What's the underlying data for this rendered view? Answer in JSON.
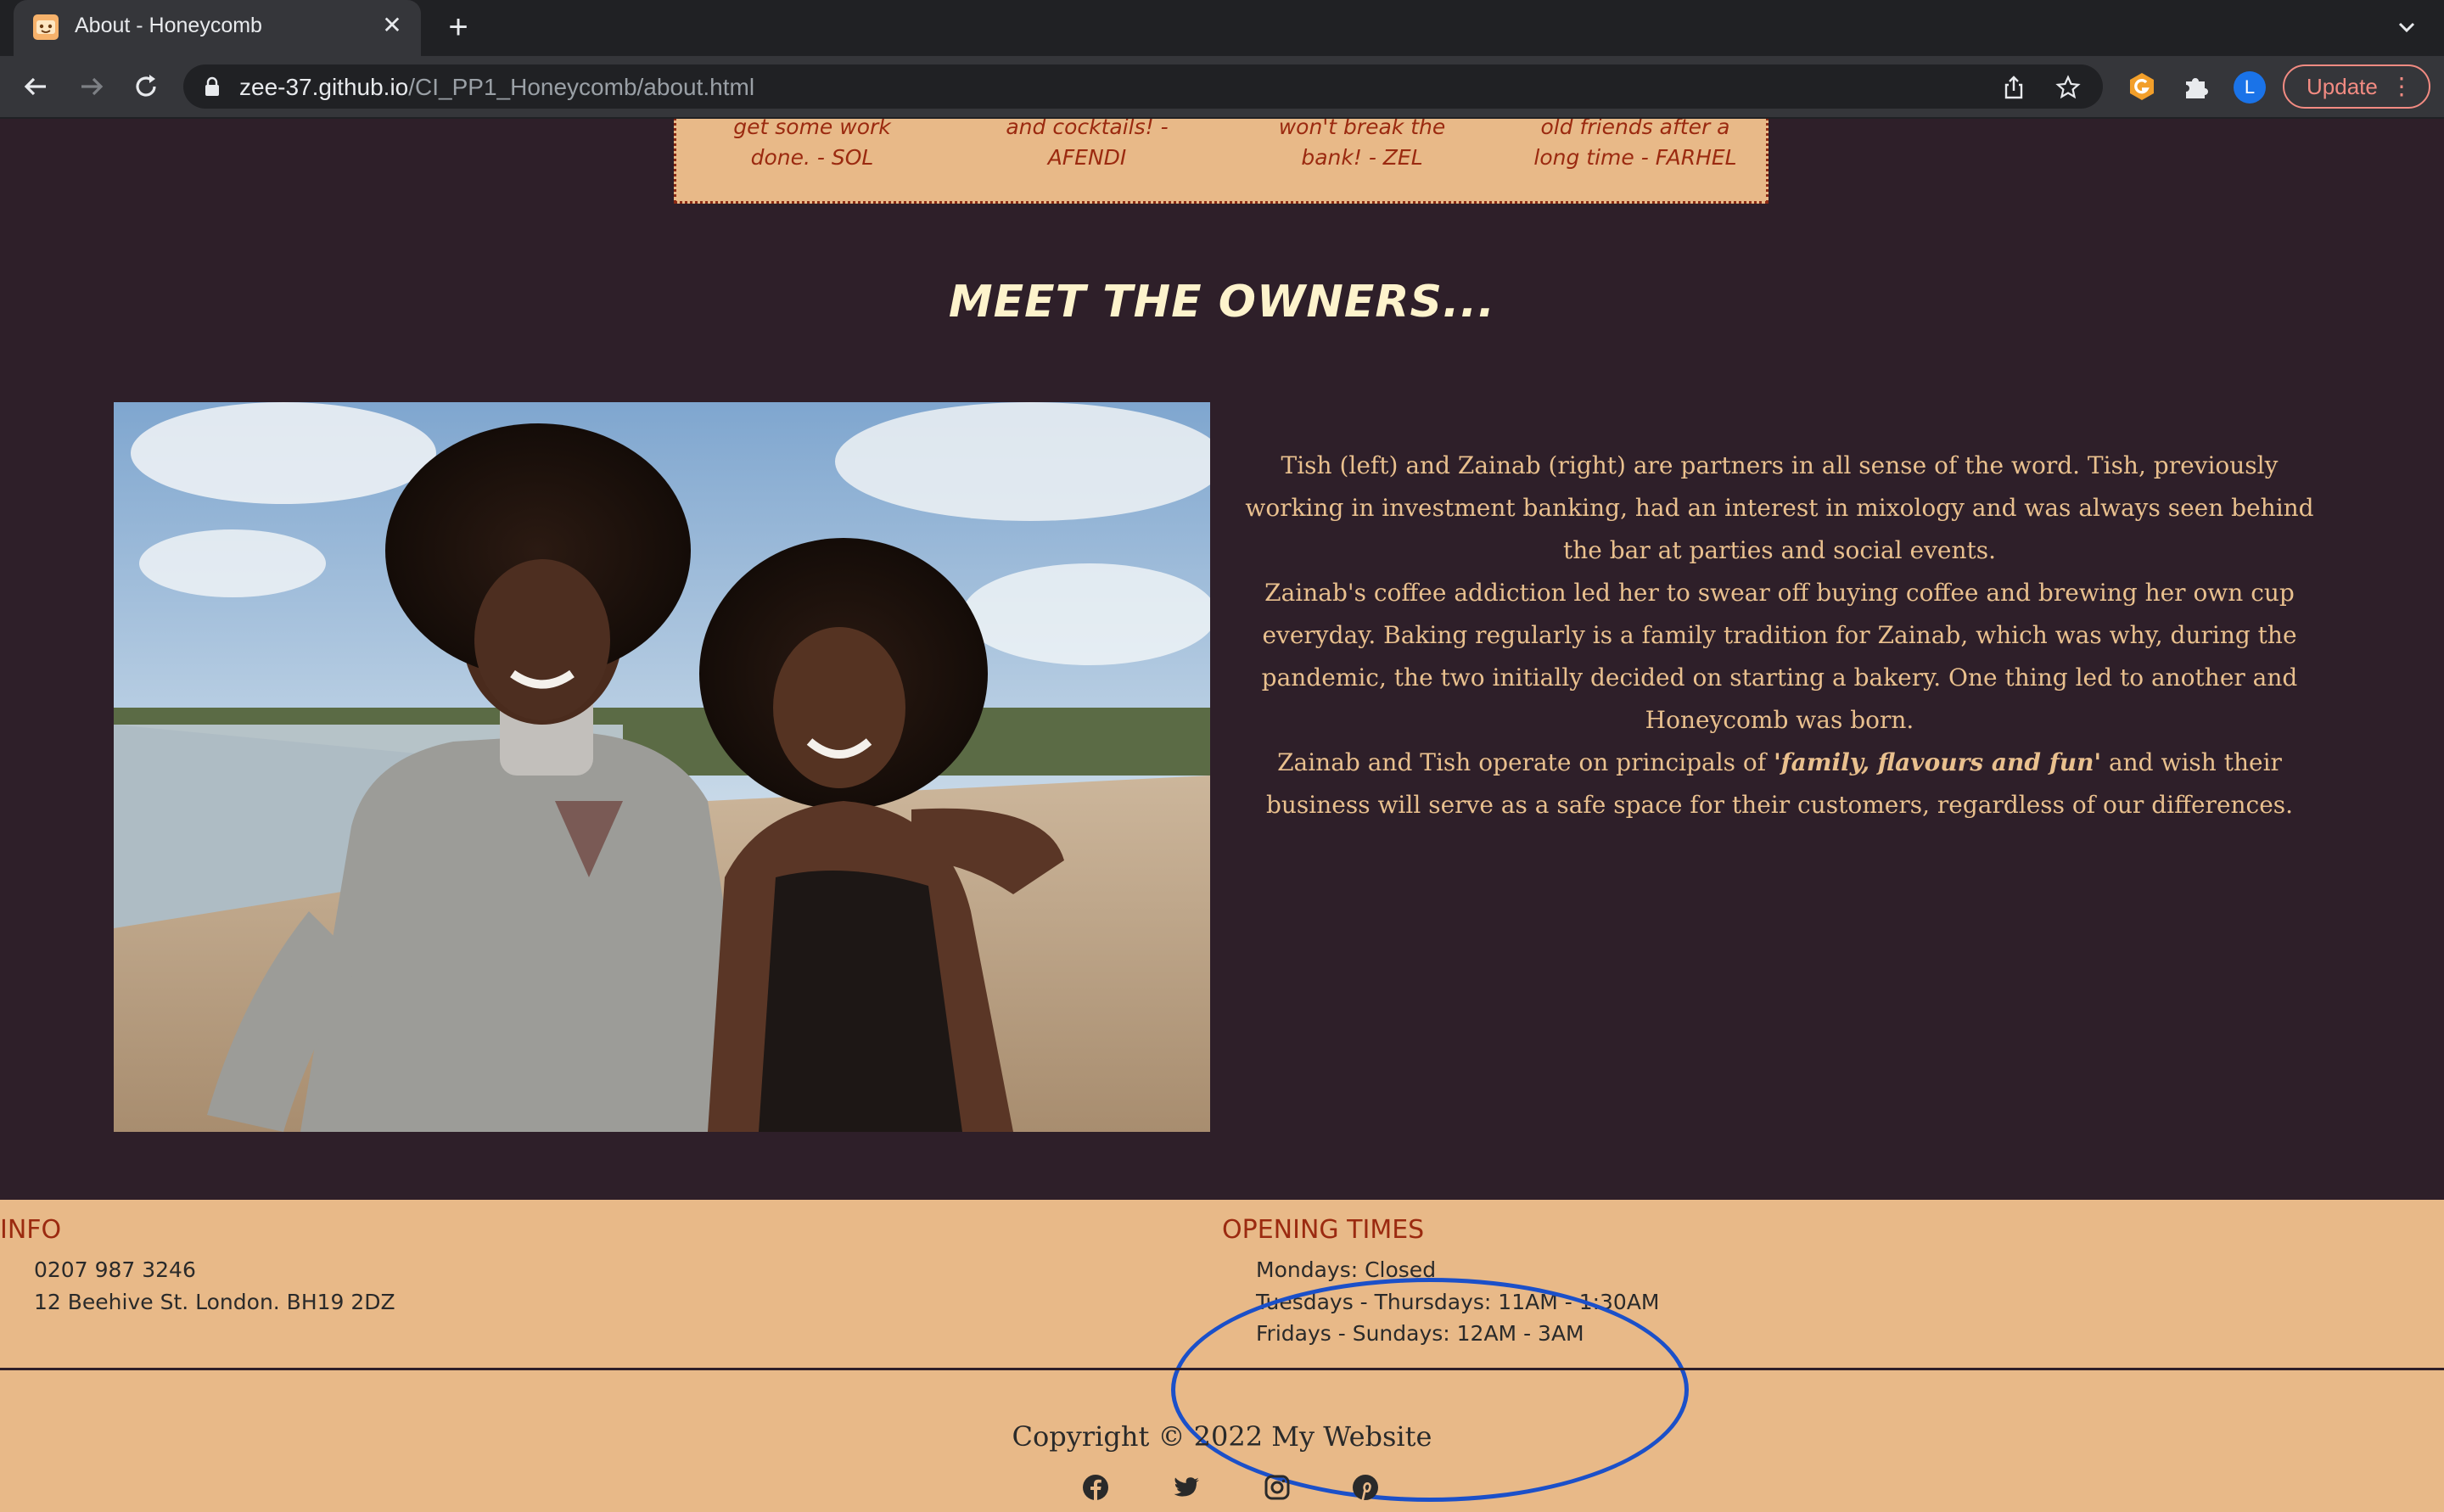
{
  "browser": {
    "tab_title": "About - Honeycomb",
    "close_glyph": "✕",
    "new_tab_glyph": "+",
    "url_host": "zee-37.github.io",
    "url_path": "/CI_PP1_Honeycomb/about.html",
    "profile_initial": "L",
    "update_label": "Update",
    "update_menu_glyph": "⋮"
  },
  "reviews": [
    {
      "text": "get some work done. - SOL"
    },
    {
      "text": "and cocktails! - AFENDI"
    },
    {
      "text": "won't break the bank! - ZEL"
    },
    {
      "text": "old friends after a long time - FARHEL"
    }
  ],
  "owners": {
    "heading": "MEET THE OWNERS...",
    "p1": "Tish (left) and Zainab (right) are partners in all sense of the word. Tish, previously working in investment banking, had an interest in mixology and was always seen behind the bar at parties and social events.",
    "p2": "Zainab's coffee addiction led her to swear off buying coffee and brewing her own cup everyday. Baking regularly is a family tradition for Zainab, which was why, during the pandemic, the two initially decided on starting a bakery. One thing led to another and Honeycomb was born.",
    "p3_before": "Zainab and Tish operate on principals of ",
    "p3_emphasis": "'family, flavours and fun'",
    "p3_after": " and wish their business will serve as a safe space for their customers, regardless of our differences."
  },
  "footer": {
    "info_title": "INFO",
    "phone": "0207 987 3246",
    "address": "12 Beehive St. London. BH19 2DZ",
    "hours_title": "OPENING TIMES",
    "hours": [
      "Mondays: Closed",
      "Tuesdays - Thursdays: 11AM - 1:30AM",
      "Fridays - Sundays: 12AM - 3AM"
    ],
    "copyright": "Copyright © 2022 My Website",
    "social_icons": [
      "facebook-icon",
      "twitter-icon",
      "instagram-icon",
      "pinterest-icon"
    ]
  },
  "colors": {
    "page_bg": "#2e1f29",
    "footer_bg": "#e8b988",
    "accent_red": "#9b2a10",
    "heading_cream": "#fdf3cc",
    "body_tan": "#e9c08e",
    "annotation_blue": "#1b50c9"
  }
}
